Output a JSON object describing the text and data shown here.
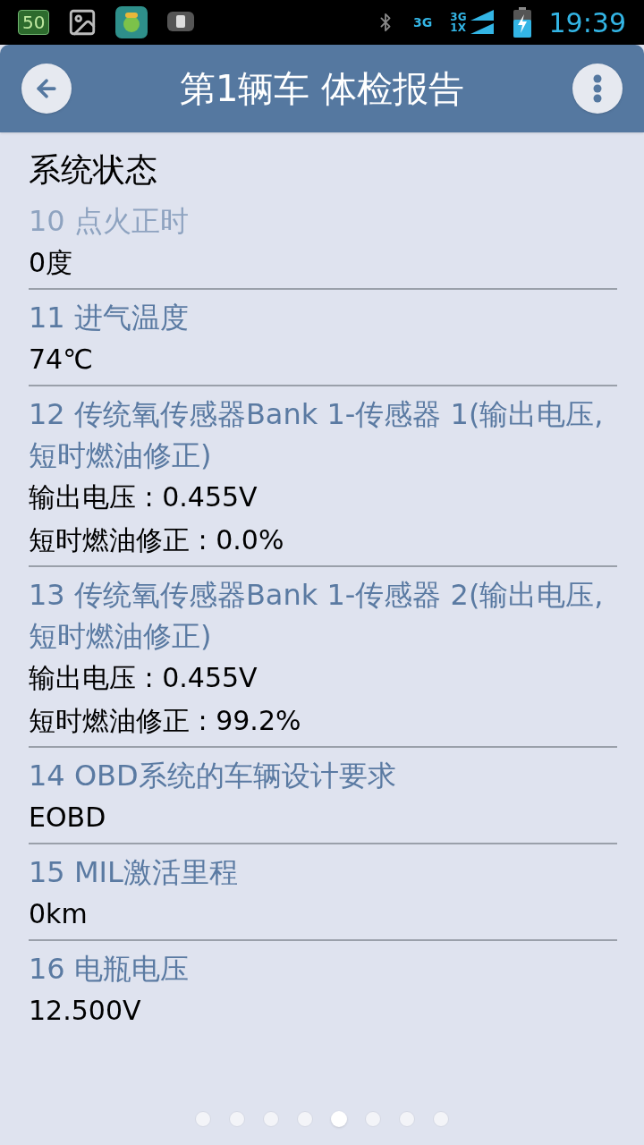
{
  "status_bar": {
    "notification_badge": "50",
    "network_1": "3G",
    "network_2_top": "3G",
    "network_2_bottom": "1X",
    "time": "19:39"
  },
  "header": {
    "title": "第1辆车 体检报告"
  },
  "section": {
    "title": "系统状态"
  },
  "items": [
    {
      "name": "10 点火正时",
      "faded": true,
      "values": [
        "0度"
      ]
    },
    {
      "name": "11 进气温度",
      "faded": false,
      "values": [
        "74℃"
      ]
    },
    {
      "name": "12 传统氧传感器Bank 1-传感器 1(输出电压,短时燃油修正)",
      "faded": false,
      "values": [
        "输出电压 : 0.455V",
        "短时燃油修正 : 0.0%"
      ]
    },
    {
      "name": "13 传统氧传感器Bank 1-传感器 2(输出电压,短时燃油修正)",
      "faded": false,
      "values": [
        "输出电压 : 0.455V",
        "短时燃油修正 : 99.2%"
      ]
    },
    {
      "name": "14 OBD系统的车辆设计要求",
      "faded": false,
      "values": [
        "EOBD"
      ]
    },
    {
      "name": "15 MIL激活里程",
      "faded": false,
      "values": [
        "0km"
      ]
    },
    {
      "name": "16 电瓶电压",
      "faded": false,
      "values": [
        "12.500V"
      ]
    }
  ],
  "pages": [
    {
      "selected": false
    },
    {
      "selected": false
    },
    {
      "selected": false
    },
    {
      "selected": false
    },
    {
      "selected": true
    },
    {
      "selected": false
    },
    {
      "selected": false
    },
    {
      "selected": false
    }
  ]
}
